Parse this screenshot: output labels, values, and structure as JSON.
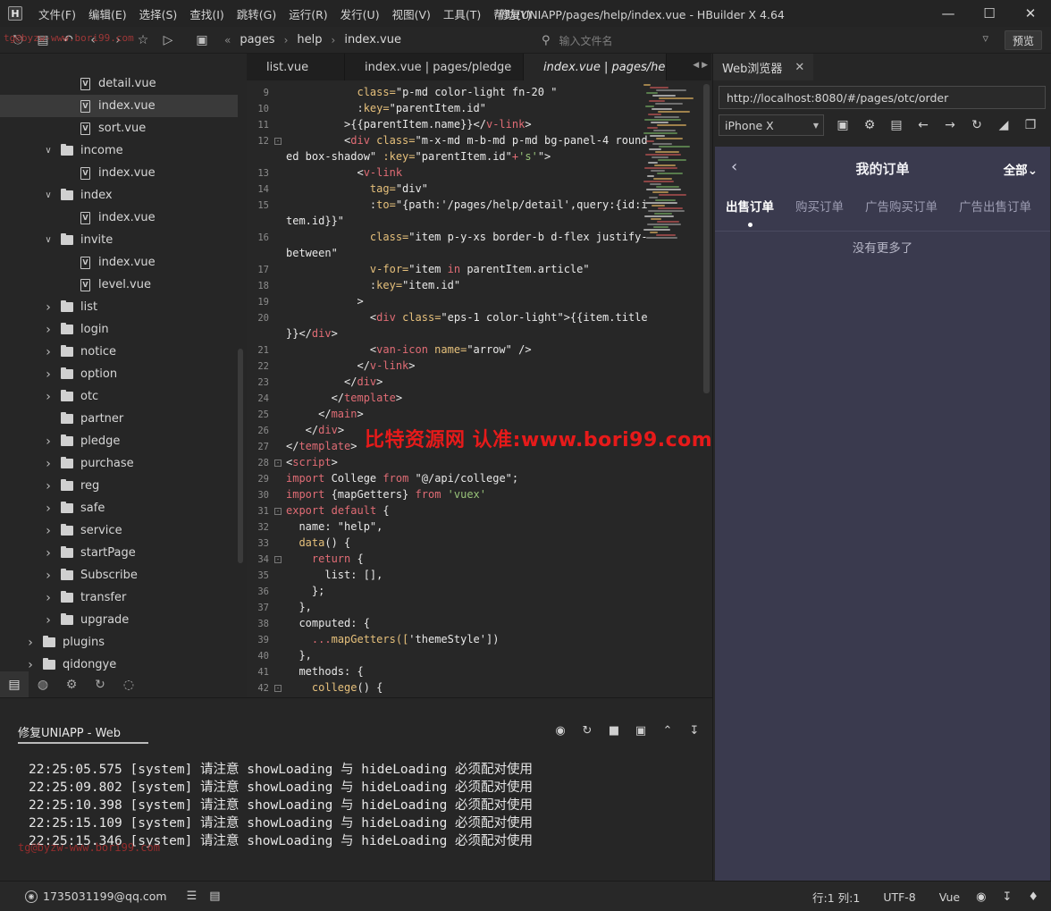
{
  "app": {
    "logo": "H",
    "title": "修复UNIAPP/pages/help/index.vue - HBuilder X 4.64"
  },
  "menu": [
    "文件(F)",
    "编辑(E)",
    "选择(S)",
    "查找(I)",
    "跳转(G)",
    "运行(R)",
    "发行(U)",
    "视图(V)",
    "工具(T)",
    "帮助(Y)"
  ],
  "toolbar": {
    "breadcrumb": [
      "pages",
      "help",
      "index.vue"
    ],
    "file_search_placeholder": "输入文件名",
    "preview_label": "预览"
  },
  "watermarks": {
    "top": "tg@byzw-www.bori99.com",
    "center": "比特资源网 认准:www.bori99.com",
    "console": "tg@byzw-www.bori99.com"
  },
  "tree": [
    {
      "label": "detail.vue",
      "type": "file",
      "level": 2
    },
    {
      "label": "index.vue",
      "type": "file",
      "level": 2,
      "selected": true
    },
    {
      "label": "sort.vue",
      "type": "file",
      "level": 2
    },
    {
      "label": "income",
      "type": "folder",
      "level": 1,
      "expanded": true
    },
    {
      "label": "index.vue",
      "type": "file",
      "level": 2
    },
    {
      "label": "index",
      "type": "folder",
      "level": 1,
      "expanded": true
    },
    {
      "label": "index.vue",
      "type": "file",
      "level": 2
    },
    {
      "label": "invite",
      "type": "folder",
      "level": 1,
      "expanded": true
    },
    {
      "label": "index.vue",
      "type": "file",
      "level": 2
    },
    {
      "label": "level.vue",
      "type": "file",
      "level": 2
    },
    {
      "label": "list",
      "type": "folder",
      "level": 1
    },
    {
      "label": "login",
      "type": "folder",
      "level": 1
    },
    {
      "label": "notice",
      "type": "folder",
      "level": 1
    },
    {
      "label": "option",
      "type": "folder",
      "level": 1
    },
    {
      "label": "otc",
      "type": "folder",
      "level": 1
    },
    {
      "label": "partner",
      "type": "folder",
      "level": 1,
      "noarrow": true
    },
    {
      "label": "pledge",
      "type": "folder",
      "level": 1
    },
    {
      "label": "purchase",
      "type": "folder",
      "level": 1
    },
    {
      "label": "reg",
      "type": "folder",
      "level": 1
    },
    {
      "label": "safe",
      "type": "folder",
      "level": 1
    },
    {
      "label": "service",
      "type": "folder",
      "level": 1
    },
    {
      "label": "startPage",
      "type": "folder",
      "level": 1
    },
    {
      "label": "Subscribe",
      "type": "folder",
      "level": 1
    },
    {
      "label": "transfer",
      "type": "folder",
      "level": 1
    },
    {
      "label": "upgrade",
      "type": "folder",
      "level": 1
    },
    {
      "label": "plugins",
      "type": "folder",
      "level": 0
    },
    {
      "label": "qidongye",
      "type": "folder",
      "level": 0
    }
  ],
  "editor_tabs": [
    "list.vue",
    "index.vue | pages/pledge",
    "index.vue | pages/help"
  ],
  "code_lines": [
    {
      "n": "9",
      "t": [
        [
          "           ",
          "#ddd"
        ],
        [
          "class=",
          "#e6c07b"
        ],
        [
          "\"p-md color-light fn-20 \"",
          "#e8e8e8"
        ]
      ]
    },
    {
      "n": "10",
      "t": [
        [
          "           :",
          "#ddd"
        ],
        [
          "key=",
          "#e6c07b"
        ],
        [
          "\"parentItem.id\"",
          "#e8e8e8"
        ]
      ]
    },
    {
      "n": "11",
      "t": [
        [
          "         >{{parentItem.name}}</",
          "#e8e8e8"
        ],
        [
          "v-link",
          "#e06c75"
        ],
        [
          ">",
          "#e8e8e8"
        ]
      ]
    },
    {
      "n": "12",
      "fold": true,
      "t": [
        [
          "         <",
          "#e8e8e8"
        ],
        [
          "div",
          "#e06c75"
        ],
        [
          " class=",
          "#e6c07b"
        ],
        [
          "\"m-x-md m-b-md p-md bg-panel-4 round",
          "#e8e8e8"
        ]
      ]
    },
    {
      "n": "",
      "t": [
        [
          "ed box-shadow\"",
          "#e8e8e8"
        ],
        [
          " :key=",
          "#e6c07b"
        ],
        [
          "\"parentItem.id\"",
          "#e8e8e8"
        ],
        [
          "+",
          "#e06c75"
        ],
        [
          "'s'",
          "#98c379"
        ],
        [
          "\">",
          "#e8e8e8"
        ]
      ]
    },
    {
      "n": "13",
      "t": [
        [
          "           <",
          "#e8e8e8"
        ],
        [
          "v-link",
          "#e06c75"
        ]
      ]
    },
    {
      "n": "14",
      "t": [
        [
          "             ",
          "#ddd"
        ],
        [
          "tag=",
          "#e6c07b"
        ],
        [
          "\"div\"",
          "#e8e8e8"
        ]
      ]
    },
    {
      "n": "15",
      "t": [
        [
          "             :",
          "#ddd"
        ],
        [
          "to=",
          "#e6c07b"
        ],
        [
          "\"{path:'/pages/help/detail',query:{id:i",
          "#e8e8e8"
        ]
      ]
    },
    {
      "n": "",
      "t": [
        [
          "tem.id}}\"",
          "#e8e8e8"
        ]
      ]
    },
    {
      "n": "16",
      "t": [
        [
          "             ",
          "#ddd"
        ],
        [
          "class=",
          "#e6c07b"
        ],
        [
          "\"item p-y-xs border-b d-flex justify-",
          "#e8e8e8"
        ]
      ]
    },
    {
      "n": "",
      "t": [
        [
          "between\"",
          "#e8e8e8"
        ]
      ]
    },
    {
      "n": "17",
      "t": [
        [
          "             ",
          "#ddd"
        ],
        [
          "v-for=",
          "#e6c07b"
        ],
        [
          "\"item ",
          "#e8e8e8"
        ],
        [
          "in",
          "#e06c75"
        ],
        [
          " parentItem.article\"",
          "#e8e8e8"
        ]
      ]
    },
    {
      "n": "18",
      "t": [
        [
          "             :",
          "#ddd"
        ],
        [
          "key=",
          "#e6c07b"
        ],
        [
          "\"item.id\"",
          "#e8e8e8"
        ]
      ]
    },
    {
      "n": "19",
      "t": [
        [
          "           >",
          "#e8e8e8"
        ]
      ]
    },
    {
      "n": "20",
      "t": [
        [
          "             <",
          "#e8e8e8"
        ],
        [
          "div",
          "#e06c75"
        ],
        [
          " class=",
          "#e6c07b"
        ],
        [
          "\"eps-1 color-light\"",
          "#e8e8e8"
        ],
        [
          ">{{item.title",
          "#e8e8e8"
        ]
      ]
    },
    {
      "n": "",
      "t": [
        [
          "}}</",
          "#e8e8e8"
        ],
        [
          "div",
          "#e06c75"
        ],
        [
          ">",
          "#e8e8e8"
        ]
      ]
    },
    {
      "n": "21",
      "t": [
        [
          "             <",
          "#e8e8e8"
        ],
        [
          "van-icon",
          "#e06c75"
        ],
        [
          " name=",
          "#e6c07b"
        ],
        [
          "\"arrow\"",
          "#e8e8e8"
        ],
        [
          " />",
          "#e8e8e8"
        ]
      ]
    },
    {
      "n": "22",
      "t": [
        [
          "           </",
          "#e8e8e8"
        ],
        [
          "v-link",
          "#e06c75"
        ],
        [
          ">",
          "#e8e8e8"
        ]
      ]
    },
    {
      "n": "23",
      "t": [
        [
          "         </",
          "#e8e8e8"
        ],
        [
          "div",
          "#e06c75"
        ],
        [
          ">",
          "#e8e8e8"
        ]
      ]
    },
    {
      "n": "24",
      "t": [
        [
          "       </",
          "#e8e8e8"
        ],
        [
          "template",
          "#e06c75"
        ],
        [
          ">",
          "#e8e8e8"
        ]
      ]
    },
    {
      "n": "25",
      "t": [
        [
          "     </",
          "#e8e8e8"
        ],
        [
          "main",
          "#e06c75"
        ],
        [
          ">",
          "#e8e8e8"
        ]
      ]
    },
    {
      "n": "26",
      "t": [
        [
          "   </",
          "#e8e8e8"
        ],
        [
          "div",
          "#e06c75"
        ],
        [
          ">",
          "#e8e8e8"
        ]
      ]
    },
    {
      "n": "27",
      "t": [
        [
          "</",
          "#e8e8e8"
        ],
        [
          "template",
          "#e06c75"
        ],
        [
          ">",
          "#e8e8e8"
        ]
      ]
    },
    {
      "n": "28",
      "fold": true,
      "t": [
        [
          "<",
          "#e8e8e8"
        ],
        [
          "script",
          "#e06c75"
        ],
        [
          ">",
          "#e8e8e8"
        ]
      ]
    },
    {
      "n": "29",
      "t": [
        [
          "import",
          "#e06c75"
        ],
        [
          " College ",
          "#e8e8e8"
        ],
        [
          "from",
          "#e06c75"
        ],
        [
          " \"@/api/college\"",
          "#e8e8e8"
        ],
        [
          ";",
          "#e8e8e8"
        ]
      ]
    },
    {
      "n": "30",
      "t": [
        [
          "import",
          "#e06c75"
        ],
        [
          " {mapGetters} ",
          "#e8e8e8"
        ],
        [
          "from",
          "#e06c75"
        ],
        [
          " 'vuex'",
          "#98c379"
        ]
      ]
    },
    {
      "n": "31",
      "fold": true,
      "t": [
        [
          "export",
          "#e06c75"
        ],
        [
          " ",
          "#e8e8e8"
        ],
        [
          "default",
          "#e06c75"
        ],
        [
          " {",
          "#e8e8e8"
        ]
      ]
    },
    {
      "n": "32",
      "t": [
        [
          "  name: ",
          "#e8e8e8"
        ],
        [
          "\"help\"",
          "#e8e8e8"
        ],
        [
          ",",
          "#e8e8e8"
        ]
      ]
    },
    {
      "n": "33",
      "t": [
        [
          "  ",
          "#e8e8e8"
        ],
        [
          "data",
          "#e6c07b"
        ],
        [
          "() {",
          "#e8e8e8"
        ]
      ]
    },
    {
      "n": "34",
      "fold": true,
      "t": [
        [
          "    ",
          "#e8e8e8"
        ],
        [
          "return",
          "#e06c75"
        ],
        [
          " {",
          "#e8e8e8"
        ]
      ]
    },
    {
      "n": "35",
      "t": [
        [
          "      list: [],",
          "#e8e8e8"
        ]
      ]
    },
    {
      "n": "36",
      "t": [
        [
          "    };",
          "#e8e8e8"
        ]
      ]
    },
    {
      "n": "37",
      "t": [
        [
          "  },",
          "#e8e8e8"
        ]
      ]
    },
    {
      "n": "38",
      "t": [
        [
          "  computed: {",
          "#e8e8e8"
        ]
      ]
    },
    {
      "n": "39",
      "t": [
        [
          "    ",
          "#e8e8e8"
        ],
        [
          "...",
          "#e06c75"
        ],
        [
          "mapGetters([",
          "#e6c07b"
        ],
        [
          "'themeStyle'",
          "#e8e8e8"
        ],
        [
          "])",
          "#e8e8e8"
        ]
      ]
    },
    {
      "n": "40",
      "t": [
        [
          "  },",
          "#e8e8e8"
        ]
      ]
    },
    {
      "n": "41",
      "t": [
        [
          "  methods: {",
          "#e8e8e8"
        ]
      ]
    },
    {
      "n": "42",
      "fold": true,
      "t": [
        [
          "    ",
          "#e8e8e8"
        ],
        [
          "college",
          "#e6c07b"
        ],
        [
          "() {",
          "#e8e8e8"
        ]
      ]
    }
  ],
  "browser": {
    "tab_label": "Web浏览器",
    "url": "http://localhost:8080/#/pages/otc/order",
    "device": "iPhone X",
    "phone": {
      "title": "我的订单",
      "filter": "全部",
      "tabs": [
        "出售订单",
        "购买订单",
        "广告购买订单",
        "广告出售订单"
      ],
      "empty": "没有更多了"
    }
  },
  "console": {
    "tab": "修复UNIAPP - Web",
    "logs": [
      "22:25:05.575 [system] 请注意 showLoading 与 hideLoading 必须配对使用",
      "22:25:09.802 [system] 请注意 showLoading 与 hideLoading 必须配对使用",
      "22:25:10.398 [system] 请注意 showLoading 与 hideLoading 必须配对使用",
      "22:25:15.109 [system] 请注意 showLoading 与 hideLoading 必须配对使用",
      "22:25:15.346 [system] 请注意 showLoading 与 hideLoading 必须配对使用"
    ]
  },
  "status": {
    "user": "1735031199@qq.com",
    "position": "行:1  列:1",
    "encoding": "UTF-8",
    "language": "Vue"
  },
  "colors": {
    "accent": "#e61a1a",
    "phone_bg": "#3a3a4e"
  }
}
